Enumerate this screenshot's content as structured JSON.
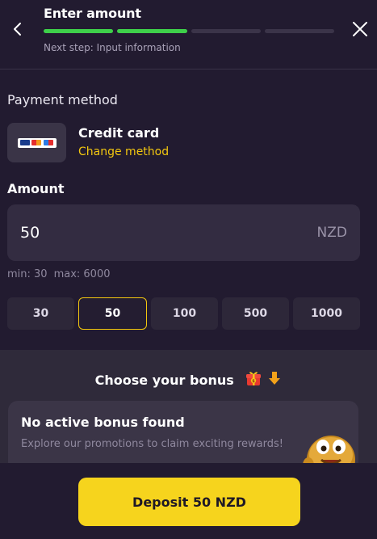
{
  "header": {
    "title": "Enter amount",
    "next_step": "Next step: Input information",
    "progress_total": 4,
    "progress_done": 2
  },
  "payment": {
    "section_label": "Payment method",
    "method_name": "Credit card",
    "change_label": "Change method",
    "card_brands": [
      "VISA",
      "Mastercard",
      "Maestro"
    ]
  },
  "amount": {
    "label": "Amount",
    "value": "50",
    "currency": "NZD",
    "min_label": "min: 30",
    "max_label": "max: 6000"
  },
  "presets": [
    {
      "label": "30",
      "selected": false
    },
    {
      "label": "50",
      "selected": true
    },
    {
      "label": "100",
      "selected": false
    },
    {
      "label": "500",
      "selected": false
    },
    {
      "label": "1000",
      "selected": false
    }
  ],
  "bonus": {
    "title": "Choose your bonus",
    "card_title": "No active bonus found",
    "card_desc": "Explore our promotions to claim exciting rewards!"
  },
  "footer": {
    "deposit_label": "Deposit 50 NZD"
  },
  "colors": {
    "background": "#221b30",
    "accent": "#f3c70f",
    "progress": "#3ed04a",
    "button": "#f6d41d"
  }
}
